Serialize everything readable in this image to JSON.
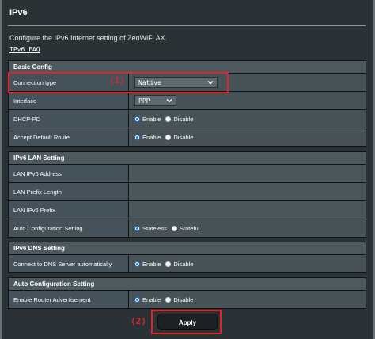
{
  "page": {
    "title": "IPv6",
    "description": "Configure the IPv6 Internet setting of ZenWiFi AX.",
    "faq_link": "IPv6_FAQ"
  },
  "sections": {
    "basic": {
      "header": "Basic Config",
      "connection_type": {
        "label": "Connection type",
        "value": "Native"
      },
      "interface": {
        "label": "Interface",
        "value": "PPP"
      },
      "dhcp_pd": {
        "label": "DHCP-PD",
        "opt1": "Enable",
        "opt2": "Disable",
        "selected": "Enable"
      },
      "accept_default_route": {
        "label": "Accept Default Route",
        "opt1": "Enable",
        "opt2": "Disable",
        "selected": "Enable"
      }
    },
    "lan": {
      "header": "IPv6 LAN Setting",
      "lan_address": {
        "label": "LAN IPv6 Address"
      },
      "prefix_length": {
        "label": "LAN Prefix Length"
      },
      "lan_prefix": {
        "label": "LAN IPv6 Prefix"
      },
      "auto_config": {
        "label": "Auto Configuration Setting",
        "opt1": "Stateless",
        "opt2": "Stateful",
        "selected": "Stateless"
      }
    },
    "dns": {
      "header": "IPv6 DNS Setting",
      "auto_dns": {
        "label": "Connect to DNS Server automatically",
        "opt1": "Enable",
        "opt2": "Disable",
        "selected": "Enable"
      }
    },
    "autoconf": {
      "header": "Auto Configuration Setting",
      "router_adv": {
        "label": "Enable Router Advertisement",
        "opt1": "Enable",
        "opt2": "Disable",
        "selected": "Enable"
      }
    }
  },
  "apply_label": "Apply",
  "annotations": {
    "marker1": "(1)",
    "marker2": "(2)"
  },
  "colors": {
    "highlight": "#e5222a",
    "radio_selected": "#1d73d6"
  }
}
